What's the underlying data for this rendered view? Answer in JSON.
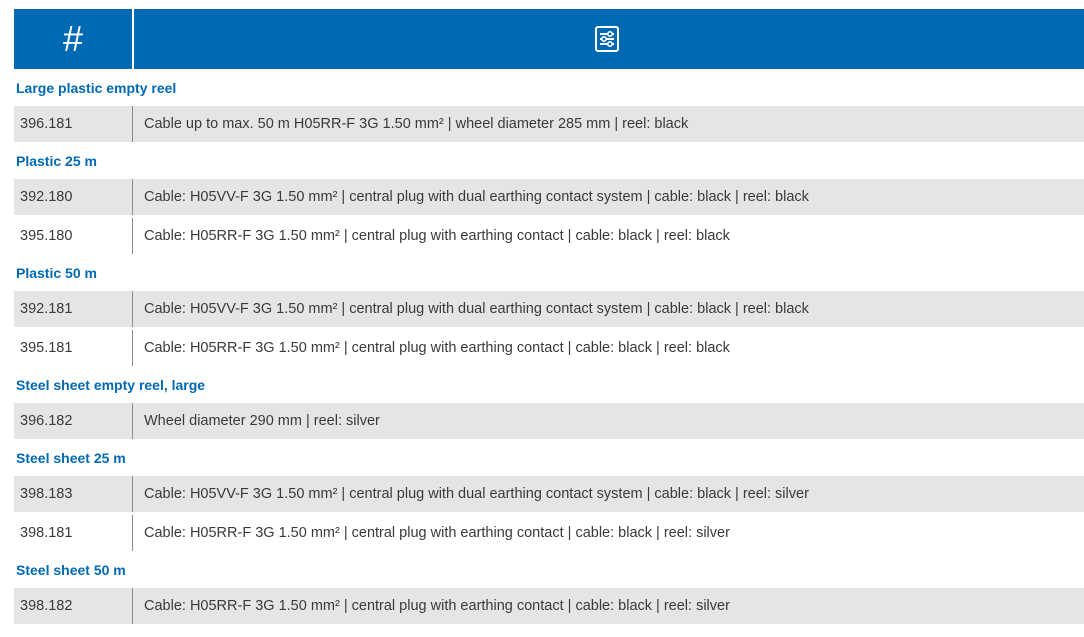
{
  "header": {
    "number_label": "#",
    "icon": "filter-settings-icon",
    "accent_color": "#0069b4"
  },
  "groups": [
    {
      "title": "Large plastic empty reel",
      "items": [
        {
          "code": "396.181",
          "description": "Cable up to max. 50 m H05RR-F 3G 1.50 mm² | wheel diameter 285 mm | reel: black"
        }
      ]
    },
    {
      "title": "Plastic 25 m",
      "items": [
        {
          "code": "392.180",
          "description": "Cable: H05VV-F 3G 1.50 mm² | central plug with dual earthing contact system | cable: black | reel: black"
        },
        {
          "code": "395.180",
          "description": "Cable: H05RR-F 3G 1.50 mm² | central plug with earthing contact | cable: black | reel: black"
        }
      ]
    },
    {
      "title": "Plastic 50 m",
      "items": [
        {
          "code": "392.181",
          "description": "Cable: H05VV-F 3G 1.50 mm² | central plug with dual earthing contact system | cable: black | reel: black"
        },
        {
          "code": "395.181",
          "description": "Cable: H05RR-F 3G 1.50 mm² | central plug with earthing contact | cable: black | reel: black"
        }
      ]
    },
    {
      "title": "Steel sheet empty reel, large",
      "items": [
        {
          "code": "396.182",
          "description": "Wheel diameter 290 mm | reel: silver"
        }
      ]
    },
    {
      "title": "Steel sheet 25 m",
      "items": [
        {
          "code": "398.183",
          "description": "Cable: H05VV-F 3G 1.50 mm² | central plug with dual earthing contact system | cable: black | reel: silver"
        },
        {
          "code": "398.181",
          "description": "Cable: H05RR-F 3G 1.50 mm² | central plug with earthing contact | cable: black | reel: silver"
        }
      ]
    },
    {
      "title": "Steel sheet 50 m",
      "items": [
        {
          "code": "398.182",
          "description": "Cable: H05RR-F 3G 1.50 mm² | central plug with earthing contact | cable: black | reel: silver"
        }
      ]
    }
  ]
}
